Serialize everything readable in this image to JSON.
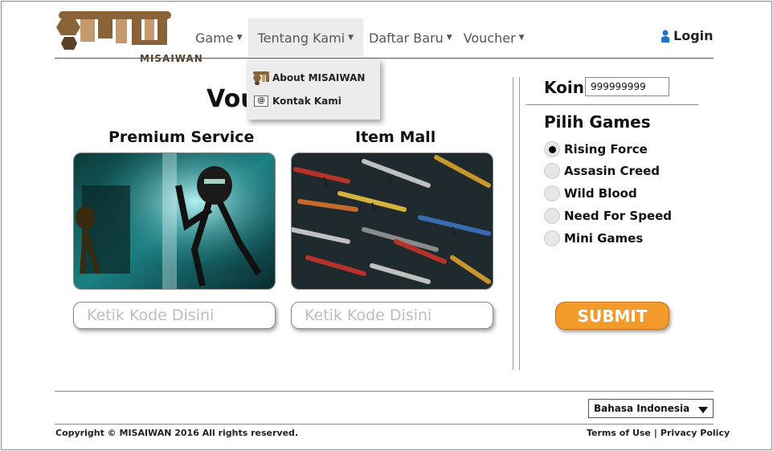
{
  "logo": {
    "text": "MISAIWAN"
  },
  "nav": {
    "items": [
      {
        "label": "Game"
      },
      {
        "label": "Tentang Kami"
      },
      {
        "label": "Daftar Baru"
      },
      {
        "label": "Voucher"
      }
    ],
    "login": "Login"
  },
  "dropdown": {
    "items": [
      {
        "label": "About MISAIWAN",
        "icon": "logo-icon"
      },
      {
        "label": "Kontak Kami",
        "icon": "at-icon"
      }
    ]
  },
  "main": {
    "title": "Vou",
    "columns": [
      {
        "title": "Premium Service",
        "placeholder": "Ketik Kode Disini"
      },
      {
        "title": "Item Mall",
        "placeholder": "Ketik Kode Disini"
      }
    ]
  },
  "sidebar": {
    "koin_label": "Koin",
    "koin_value": "999999999",
    "pilih_label": "Pilih Games",
    "games": [
      {
        "label": "Rising Force",
        "selected": true
      },
      {
        "label": "Assasin Creed",
        "selected": false
      },
      {
        "label": "Wild Blood",
        "selected": false
      },
      {
        "label": "Need For Speed",
        "selected": false
      },
      {
        "label": "Mini Games",
        "selected": false
      }
    ],
    "submit_label": "SUBMIT"
  },
  "footer": {
    "language": "Bahasa Indonesia",
    "copyright": "Copyright © MISAIWAN 2016 All rights reserved.",
    "terms": "Terms of Use",
    "privacy": "Privacy Policy"
  },
  "colors": {
    "brand_brown": "#8a6238",
    "accent_orange": "#f39b2a",
    "login_blue": "#1e73c8"
  }
}
